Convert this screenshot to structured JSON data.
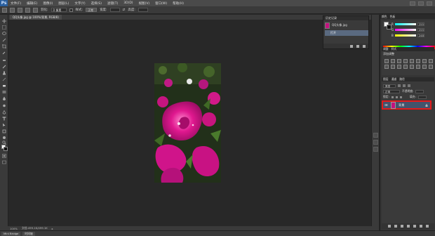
{
  "app": {
    "logo": "Ps"
  },
  "menu": [
    "文件(F)",
    "编辑(E)",
    "图像(I)",
    "图层(L)",
    "文字(Y)",
    "选择(S)",
    "滤镜(T)",
    "3D(D)",
    "视图(V)",
    "窗口(W)",
    "帮助(H)"
  ],
  "options": {
    "feather_label": "羽化:",
    "feather_value": "0 像素",
    "style_label": "样式:",
    "style_value": "正常",
    "width_label": "宽度:",
    "height_label": "高度:"
  },
  "document": {
    "tab_title": "QQ头像.jpg @ 100%(背景, RGB/8)"
  },
  "status": {
    "zoom": "100%",
    "doc_info": "文档:499.1K/499.1K"
  },
  "bottom_tabs": [
    "Mini Bridge",
    "时间轴"
  ],
  "history": {
    "title": "历史记录",
    "snapshot_name": "QQ头像.jpg",
    "open_step": "打开"
  },
  "color_panel": {
    "tabs": [
      "颜色",
      "色板"
    ],
    "r_label": "R",
    "r_value": "255",
    "g_label": "G",
    "g_value": "255",
    "b_label": "B",
    "b_value": "248",
    "fg": "#ffffff",
    "bg": "#111111"
  },
  "adjustments": {
    "tabs": [
      "调整",
      "样式"
    ],
    "title": "添加调整"
  },
  "layers_panel": {
    "tabs": [
      "图层",
      "通道",
      "路径"
    ],
    "kind_label": "类型",
    "blend_mode": "正常",
    "opacity_label": "不透明度:",
    "lock_label": "锁定:",
    "fill_label": "填充:",
    "layer_name": "背景"
  },
  "colors": {
    "accent_selection": "#43546c",
    "highlight_border": "#e31b1b",
    "photo_magenta": "#c2127e"
  }
}
